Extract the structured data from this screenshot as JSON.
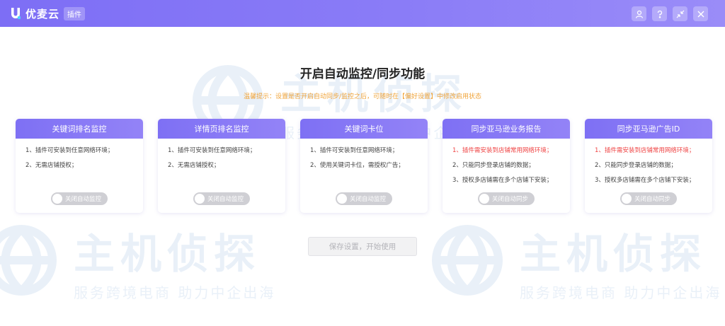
{
  "titlebar": {
    "app_name": "优麦云",
    "badge": "插件",
    "controls": [
      {
        "icon": "user-icon"
      },
      {
        "icon": "help-icon"
      },
      {
        "icon": "minimize-icon"
      },
      {
        "icon": "close-icon"
      }
    ]
  },
  "main": {
    "title": "开启自动监控/同步功能",
    "notice": "温馨提示：设置是否开启自动同步/监控之后，可随时在【偏好设置】中修改启用状态"
  },
  "cards": [
    {
      "title": "关键词排名监控",
      "items": [
        {
          "text": "1、插件可安装到任意网络环境；",
          "warn": false
        },
        {
          "text": "2、无需店铺授权；",
          "warn": false
        }
      ],
      "toggle_label": "关闭自动监控"
    },
    {
      "title": "详情页排名监控",
      "items": [
        {
          "text": "1、插件可安装到任意网络环境；",
          "warn": false
        },
        {
          "text": "2、无需店铺授权；",
          "warn": false
        }
      ],
      "toggle_label": "关闭自动监控"
    },
    {
      "title": "关键词卡位",
      "items": [
        {
          "text": "1、插件可安装到任意网络环境；",
          "warn": false
        },
        {
          "text": "2、使用关键词卡位，需授权广告；",
          "warn": false
        }
      ],
      "toggle_label": "关闭自动监控"
    },
    {
      "title": "同步亚马逊业务报告",
      "items": [
        {
          "text": "1、插件需安装到店铺常用网络环境；",
          "warn": true
        },
        {
          "text": "2、只能同步登录店铺的数据；",
          "warn": false
        },
        {
          "text": "3、授权多店铺需在多个店铺下安装；",
          "warn": false
        }
      ],
      "toggle_label": "关闭自动同步"
    },
    {
      "title": "同步亚马逊广告ID",
      "items": [
        {
          "text": "1、插件需安装到店铺常用网络环境；",
          "warn": true
        },
        {
          "text": "2、只能同步登录店铺的数据；",
          "warn": false
        },
        {
          "text": "3、授权多店铺需在多个店铺下安装；",
          "warn": false
        }
      ],
      "toggle_label": "关闭自动同步"
    }
  ],
  "save_button": "保存设置，开始使用",
  "watermark": {
    "brand": "主机侦探",
    "slogan": "服务跨境电商  助力中企出海"
  },
  "colors": {
    "accent": "#7e70f4",
    "warn": "#ef4444",
    "notice": "#f0a43a"
  }
}
